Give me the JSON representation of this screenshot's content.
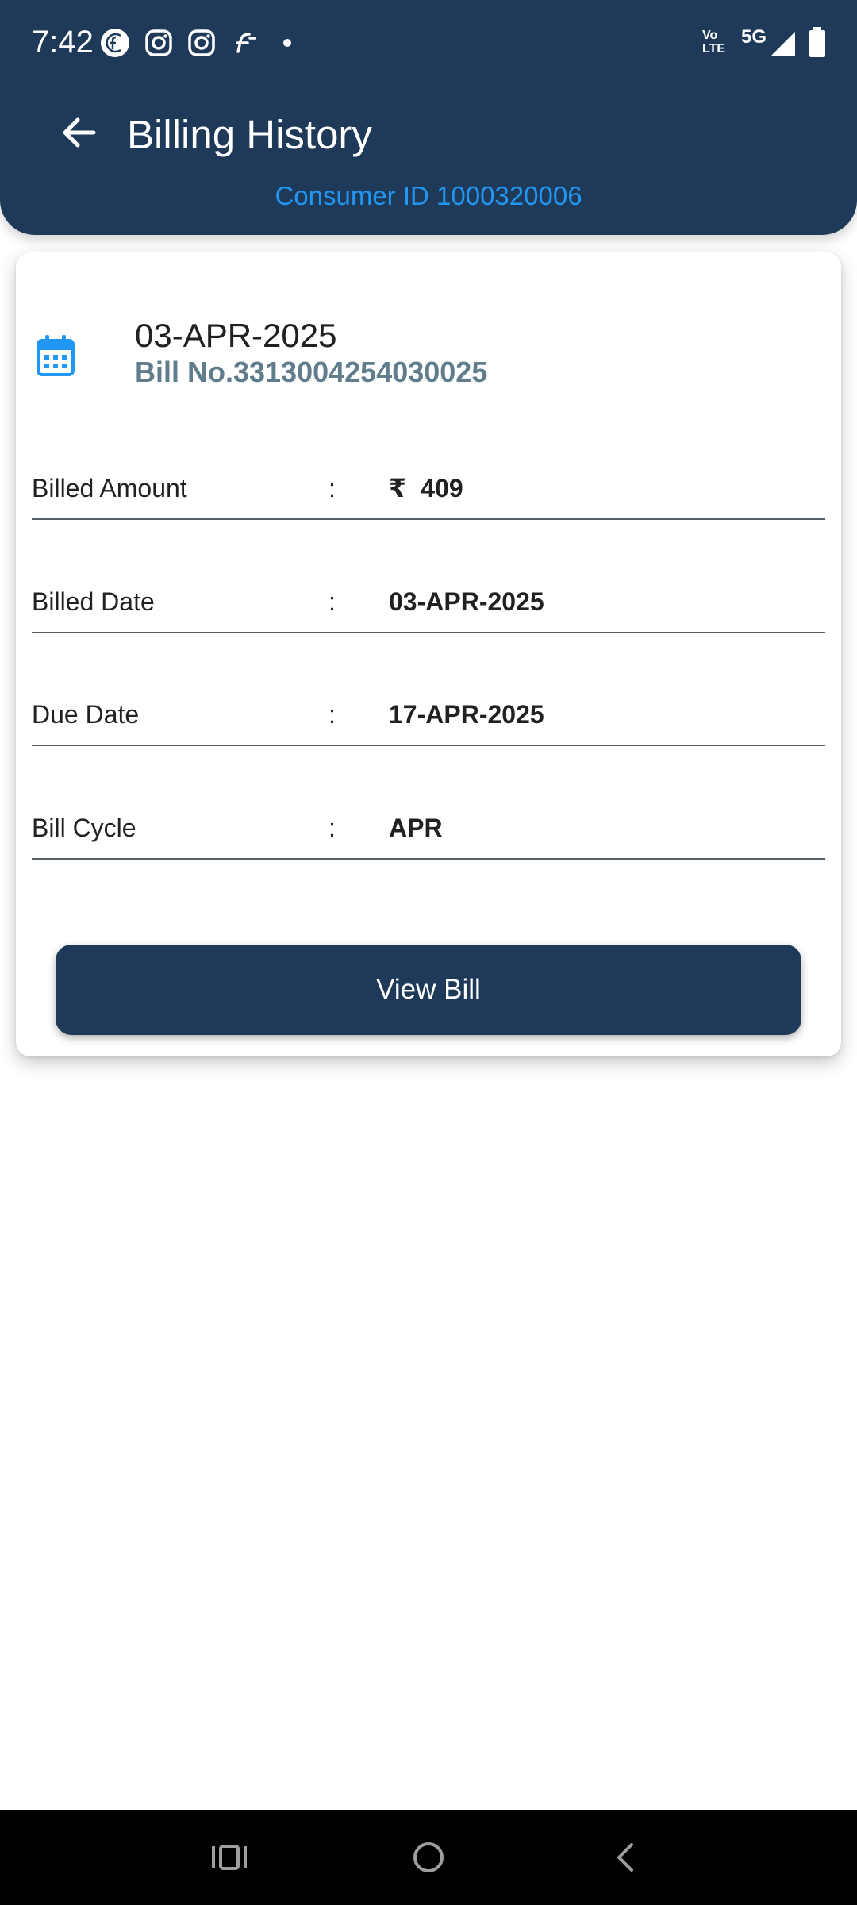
{
  "status_bar": {
    "time": "7:42",
    "network": "5G",
    "volte_line1": "Vo",
    "volte_line2": "LTE",
    "notification_icons": [
      "fc-app-icon",
      "instagram-icon",
      "instagram-icon",
      "flipkart-icon",
      "dot-icon"
    ],
    "system_icons": [
      "volte-icon",
      "signal-icon",
      "battery-icon"
    ]
  },
  "header": {
    "title": "Billing History",
    "consumer_id": "Consumer ID 1000320006",
    "back_icon": "arrow-left-icon"
  },
  "bill_card": {
    "icon": "calendar-icon",
    "date": "03-APR-2025",
    "bill_number": "Bill No.3313004254030025",
    "currency_symbol": "₹",
    "rows": [
      {
        "label": "Billed Amount",
        "separator": ":",
        "value": "409"
      },
      {
        "label": "Billed Date",
        "separator": ":",
        "value": "03-APR-2025"
      },
      {
        "label": "Due Date",
        "separator": ":",
        "value": "17-APR-2025"
      },
      {
        "label": "Bill Cycle",
        "separator": ":",
        "value": "APR"
      }
    ],
    "view_bill_label": "View Bill"
  },
  "nav_bar": {
    "buttons": [
      "recents-icon",
      "home-icon",
      "back-icon"
    ]
  },
  "colors": {
    "primary": "#1f3a58",
    "accent": "#2196f3",
    "bill_number": "#607d8b"
  }
}
